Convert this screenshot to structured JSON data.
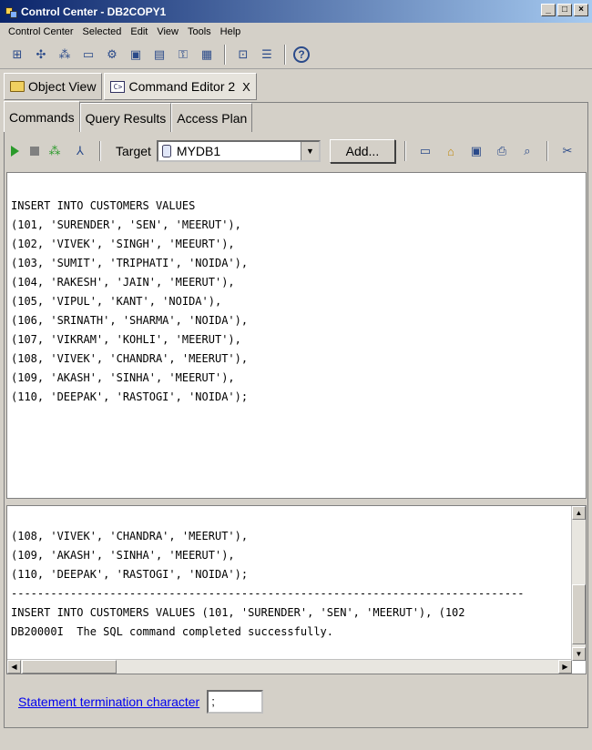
{
  "window": {
    "title": "Control Center - DB2COPY1"
  },
  "menubar": [
    "Control Center",
    "Selected",
    "Edit",
    "View",
    "Tools",
    "Help"
  ],
  "view_tabs": [
    {
      "label": "Object View"
    },
    {
      "label": "Command Editor 2",
      "close": "X"
    }
  ],
  "sub_tabs": [
    "Commands",
    "Query Results",
    "Access Plan"
  ],
  "toolbar": {
    "target_label": "Target",
    "target_value": "MYDB1",
    "add_label": "Add..."
  },
  "editor": {
    "lines": [
      "INSERT INTO CUSTOMERS VALUES",
      "(101, 'SURENDER', 'SEN', 'MEERUT'),",
      "(102, 'VIVEK', 'SINGH', 'MEEURT'),",
      "(103, 'SUMIT', 'TRIPHATI', 'NOIDA'),",
      "(104, 'RAKESH', 'JAIN', 'MEERUT'),",
      "(105, 'VIPUL', 'KANT', 'NOIDA'),",
      "(106, 'SRINATH', 'SHARMA', 'NOIDA'),",
      "(107, 'VIKRAM', 'KOHLI', 'MEERUT'),",
      "(108, 'VIVEK', 'CHANDRA', 'MEERUT'),",
      "(109, 'AKASH', 'SINHA', 'MEERUT'),",
      "(110, 'DEEPAK', 'RASTOGI', 'NOIDA');"
    ]
  },
  "output": {
    "lines": [
      "(108, 'VIVEK', 'CHANDRA', 'MEERUT'),",
      "(109, 'AKASH', 'SINHA', 'MEERUT'),",
      "(110, 'DEEPAK', 'RASTOGI', 'NOIDA');",
      "------------------------------------------------------------------------------",
      "INSERT INTO CUSTOMERS VALUES (101, 'SURENDER', 'SEN', 'MEERUT'), (102",
      "DB20000I  The SQL command completed successfully."
    ]
  },
  "statement": {
    "link_label": "Statement termination character",
    "value": ";"
  }
}
